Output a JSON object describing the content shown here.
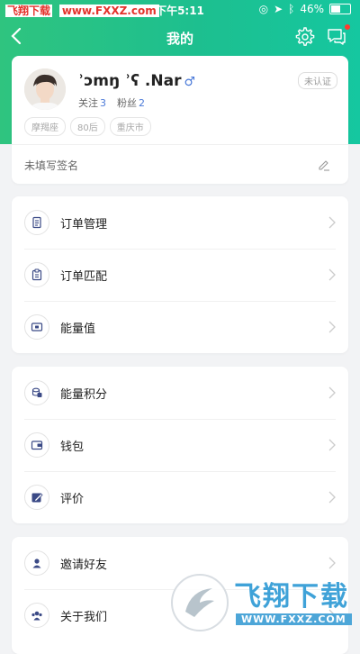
{
  "status_bar": {
    "brand": "飞翔下载",
    "url": "www.FXXZ.com",
    "time": "下午5:11",
    "battery": "46%",
    "battery_level": 0.46
  },
  "nav": {
    "title": "我的"
  },
  "profile": {
    "name": "ʾɔmŋ ʾʕ .Nar",
    "gender_symbol": "♂",
    "following_label": "关注",
    "following_count": "3",
    "followers_label": "粉丝",
    "followers_count": "2",
    "verify_label": "未认证",
    "tags": [
      "摩羯座",
      "80后",
      "重庆市"
    ],
    "signature": "未填写签名"
  },
  "menu_group_1": [
    {
      "label": "订单管理",
      "icon": "document-icon"
    },
    {
      "label": "订单匹配",
      "icon": "clipboard-icon"
    },
    {
      "label": "能量值",
      "icon": "energy-icon"
    }
  ],
  "menu_group_2": [
    {
      "label": "能量积分",
      "icon": "coins-icon"
    },
    {
      "label": "钱包",
      "icon": "wallet-icon"
    },
    {
      "label": "评价",
      "icon": "review-icon"
    }
  ],
  "menu_group_3": [
    {
      "label": "邀请好友",
      "icon": "user-icon"
    },
    {
      "label": "关于我们",
      "icon": "team-icon"
    }
  ],
  "watermark": {
    "text": "飞翔下载",
    "url": "WWW.FXXZ.COM"
  },
  "colors": {
    "accent": "#22c386",
    "link_blue": "#4a79d8",
    "icon_navy": "#3b4a86"
  }
}
